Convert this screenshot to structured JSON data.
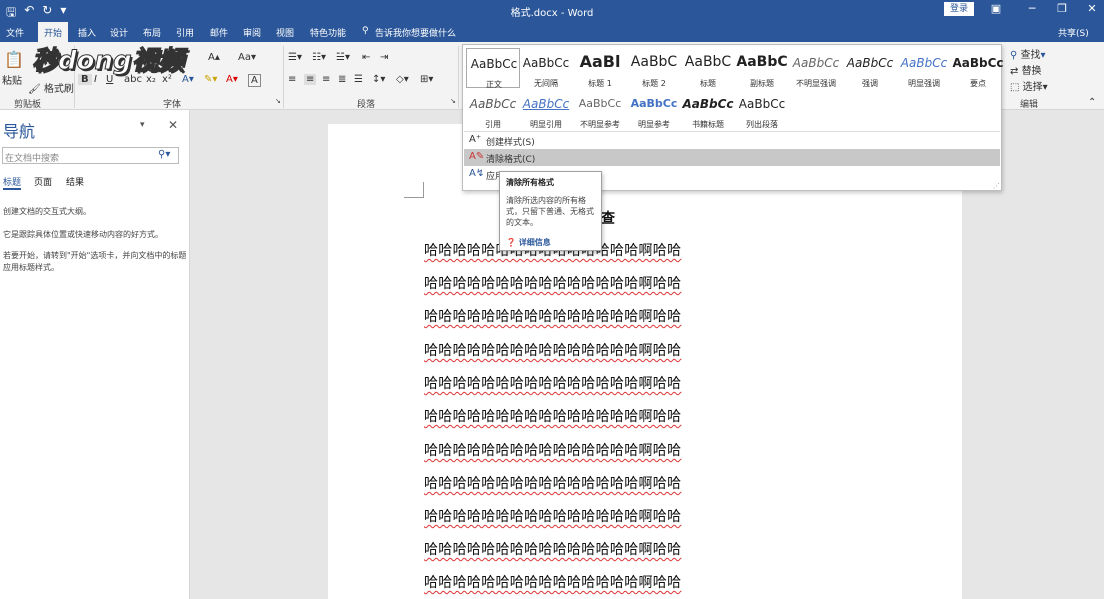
{
  "titlebar": {
    "title": "格式.docx - Word",
    "login_label": "登录",
    "colors": {
      "bg": "#2b579a"
    }
  },
  "tabs": [
    "文件",
    "开始",
    "插入",
    "设计",
    "布局",
    "引用",
    "邮件",
    "审阅",
    "视图",
    "特色功能"
  ],
  "tell_me": "告诉我你想要做什么",
  "share_label": "共享(S)",
  "ribbon": {
    "clipboard": {
      "paste": "粘贴",
      "format_painter": "格式刷",
      "group": "剪贴板"
    },
    "font": {
      "group": "字体"
    },
    "paragraph": {
      "group": "段落"
    },
    "editing": {
      "find": "查找",
      "replace": "替换",
      "select": "选择",
      "group": "编辑"
    }
  },
  "styles_gallery": {
    "row1": [
      {
        "preview": "AaBbCc",
        "name": "正文",
        "selected": true
      },
      {
        "preview": "AaBbCc",
        "name": "无间隔"
      },
      {
        "preview": "AaBl",
        "name": "标题 1"
      },
      {
        "preview": "AaBbC",
        "name": "标题 2"
      },
      {
        "preview": "AaBbC",
        "name": "标题"
      },
      {
        "preview": "AaBbC",
        "name": "副标题"
      },
      {
        "preview": "AaBbCc",
        "name": "不明显强调"
      },
      {
        "preview": "AaBbCc",
        "name": "强调"
      },
      {
        "preview": "AaBbCc",
        "name": "明显强调"
      },
      {
        "preview": "AaBbCc",
        "name": "要点"
      }
    ],
    "row2": [
      {
        "preview": "AaBbCc",
        "name": "引用"
      },
      {
        "preview": "AaBbCc",
        "name": "明显引用"
      },
      {
        "preview": "AaBbCc",
        "name": "不明显参考"
      },
      {
        "preview": "AaBbCc",
        "name": "明显参考"
      },
      {
        "preview": "AaBbCc",
        "name": "书籍标题"
      },
      {
        "preview": "AaBbCc",
        "name": "列出段落"
      }
    ],
    "menu": [
      "创建样式(S)",
      "清除格式(C)",
      "应用样式"
    ]
  },
  "tooltip": {
    "title": "清除所有格式",
    "body": "清除所选内容的所有格式，只留下普通、无格式的文本。",
    "link": "详细信息"
  },
  "navpane": {
    "title": "导航",
    "search_placeholder": "在文档中搜索",
    "tabs": [
      "标题",
      "页面",
      "结果"
    ],
    "help1": "创建文档的交互式大纲。",
    "help2": "它是跟踪具体位置或快速移动内容的好方式。",
    "help3": "若要开始，请转到\"开始\"选项卡，并向文档中的标题应用标题样式。"
  },
  "document": {
    "title": "膏的销售量调查",
    "lines": [
      "哈哈哈哈哈哈哈哈哈哈哈哈哈哈哈啊哈哈",
      "哈哈哈哈哈哈哈哈哈哈哈哈哈哈哈啊哈哈",
      "哈哈哈哈哈哈哈哈哈哈哈哈哈哈哈啊哈哈",
      "哈哈哈哈哈哈哈哈哈哈哈哈哈哈哈啊哈哈",
      "哈哈哈哈哈哈哈哈哈哈哈哈哈哈哈啊哈哈",
      "哈哈哈哈哈哈哈哈哈哈哈哈哈哈哈啊哈哈",
      "哈哈哈哈哈哈哈哈哈哈哈哈哈哈哈啊哈哈",
      "哈哈哈哈哈哈哈哈哈哈哈哈哈哈哈啊哈哈",
      "哈哈哈哈哈哈哈哈哈哈哈哈哈哈哈啊哈哈",
      "哈哈哈哈哈哈哈哈哈哈哈哈哈哈哈啊哈哈",
      "哈哈哈哈哈哈哈哈哈哈哈哈哈哈哈啊哈哈"
    ]
  },
  "watermark": "秒dong视频"
}
